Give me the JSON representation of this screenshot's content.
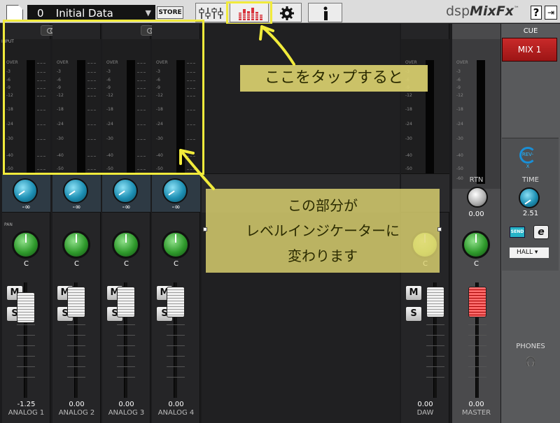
{
  "topbar": {
    "preset_number": "0",
    "preset_name": "Initial Data",
    "dropdown_arrow": "▼",
    "store_label": "STORE",
    "brand": "dspMixFx",
    "brand_dsp": "dsp",
    "brand_mix": "MixFx",
    "brand_tm": "™",
    "help_label": "?",
    "logout_icon": "logout-icon"
  },
  "tabs": [
    {
      "name": "mixer-tab",
      "icon": "mixer-faders-icon"
    },
    {
      "name": "meter-tab",
      "icon": "level-meter-icon",
      "selected": true
    },
    {
      "name": "settings-tab",
      "icon": "gear-icon"
    },
    {
      "name": "info-tab",
      "icon": "info-icon"
    }
  ],
  "labels": {
    "input": "INPUT",
    "pan": "PAN",
    "rtn": "RTN",
    "cue": "CUE",
    "time": "TIME",
    "phones": "PHONES"
  },
  "meter_scale": [
    "OVER",
    "-3",
    "-6",
    "-9",
    "-12",
    "-18",
    "-24",
    "-30",
    "-40",
    "-50",
    "-60"
  ],
  "channels": [
    {
      "name": "ANALOG 1",
      "gain": "-∞",
      "pan": "C",
      "fader": "-1.25",
      "mute": "M",
      "solo": "S"
    },
    {
      "name": "ANALOG 2",
      "gain": "-∞",
      "pan": "C",
      "fader": "0.00",
      "mute": "M",
      "solo": "S"
    },
    {
      "name": "ANALOG 3",
      "gain": "-∞",
      "pan": "C",
      "fader": "0.00",
      "mute": "M",
      "solo": "S"
    },
    {
      "name": "ANALOG 4",
      "gain": "-∞",
      "pan": "C",
      "fader": "0.00",
      "mute": "M",
      "solo": "S"
    }
  ],
  "daw": {
    "name": "DAW",
    "pan": "C",
    "fader": "0.00",
    "mute": "M",
    "solo": "S"
  },
  "master": {
    "name": "MASTER",
    "rtn_value": "0.00",
    "pan": "C",
    "fader": "0.00"
  },
  "cue_panel": {
    "mix_label": "MIX 1",
    "fx_logo": "REV-X",
    "time_value": "2.51",
    "send_label": "SEND",
    "edit_label": "e",
    "reverb_type": "HALL",
    "headphones_icon": "headphones-icon"
  },
  "annotations": {
    "callout_top": "ここをタップすると",
    "callout_main": [
      "この部分が",
      "レベルインジケーターに",
      "変わります"
    ],
    "highlight_color": "#f1eb3b"
  },
  "colors": {
    "mix_button": "#b81f1f",
    "send_button": "#27b3c7",
    "knob_blue": "#1d8fb3",
    "knob_green": "#2f9a2c"
  }
}
